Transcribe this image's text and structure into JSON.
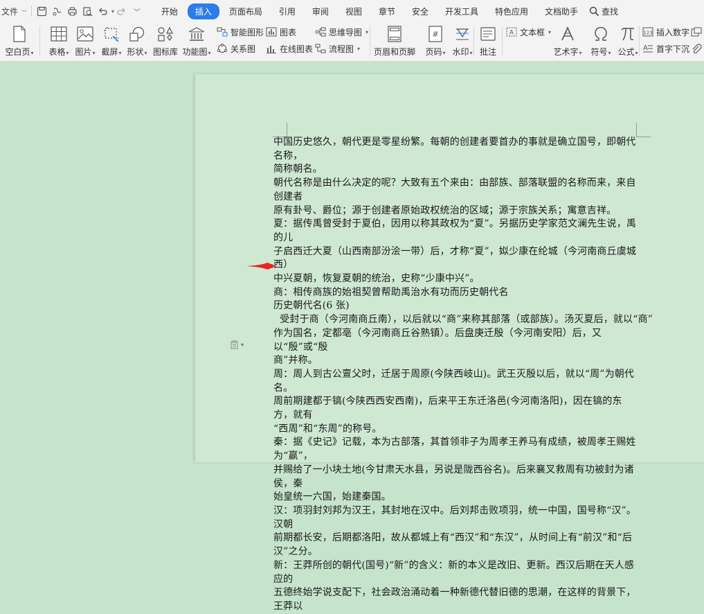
{
  "menubar": {
    "file_label": "文件",
    "quick_access": [
      "保存",
      "导出",
      "打印",
      "打印预览",
      "撤销",
      "恢复",
      "更多"
    ],
    "tabs": [
      "开始",
      "插入",
      "页面布局",
      "引用",
      "审阅",
      "视图",
      "章节",
      "安全",
      "开发工具",
      "特色应用",
      "文档助手"
    ],
    "active_tab": "插入",
    "search_label": "查找"
  },
  "ribbon": {
    "blank_page": "空白页",
    "table": "表格",
    "picture": "图片",
    "screenshot": "截屏",
    "shape": "形状",
    "icon_lib": "图标库",
    "function_chart": "功能图",
    "smart_art": "智能图形",
    "chart": "图表",
    "mind_map": "思维导图",
    "relation_chart": "关系图",
    "online_chart": "在线图表",
    "flowchart": "流程图",
    "header_footer": "页眉和页脚",
    "page_number": "页码",
    "watermark": "水印",
    "comment": "批注",
    "textbox": "文本框",
    "art_text": "艺术字",
    "symbol": "符号",
    "formula": "公式",
    "insert_number": "插入数字",
    "drop_cap": "首字下沉"
  },
  "document": {
    "lines": [
      "中国历史悠久，朝代更是零星纷繁。每朝的创建者要首办的事就是确立国号，即朝代名称，",
      "简称朝名。",
      "朝代名称是由什么决定的呢？大致有五个来由：由部族、部落联盟的名称而来，来自创建者",
      "原有卦号、爵位；源于创建者原始政权统治的区域；源于宗族关系；寓意吉祥。",
      "夏：据传禹曾受封于夏伯，因用以称其政权为“夏”。另据历史学家范文澜先生说，禹的儿",
      "子启西迁大夏（山西南部汾浍一带）后，才称“夏”，姒少康在纶城（今河南商丘虞城西）",
      "中兴夏朝，恢复夏朝的统治，史称“少康中兴”。",
      "商：相传商族的始祖契曾帮助禹治水有功而历史朝代名",
      "历史朝代名(6 张)",
      "  受封于商（今河南商丘南），以后就以“商”来称其部落（或部族）。汤灭夏后，就以“商”",
      "作为国名，定都亳（今河南商丘谷熟镇）。后盘庚迁殷（今河南安阳）后，又以“殷”或“殷",
      "商”并称。",
      "周：周人到古公亶父时，迁居于周原(今陕西岐山)。武王灭殷以后，就以“周”为朝代名。",
      "周前期建都于镐(今陕西西安西南)，后来平王东迁洛邑(今河南洛阳)，因在镐的东方，就有",
      "“西周”和“东周”的称号。",
      "秦：据《史记》记载，本为古部落，其首领非子为周孝王养马有成绩，被周孝王赐姓为“嬴”，",
      "并赐给了一小块土地(今甘肃天水县，另说是陇西谷名)。后来襄叉救周有功被封为诸侯，秦",
      "始皇统一六国，始建秦国。",
      "汉：项羽封刘邦为汉王，其封地在汉中。后刘邦击败项羽，统一中国，国号称“汉”。汉朝",
      "前期都长安，后期都洛阳，故从都城上有“西汉”和“东汉”，从时间上有“前汉”和“后",
      "汉”之分。",
      "新：王莽所创的朝代(国号)“新”的含义：新的本义是改旧、更新。西汉后期在天人感应的",
      "五德终始学说支配下，社会政治涌动着一种新德代替旧德的思潮，在这样的背景下，王莽以"
    ]
  },
  "colors": {
    "accent": "#2b7de9",
    "workspace": "#c6e4cc",
    "page": "#cfe8d2",
    "arrow": "#e8261f"
  }
}
